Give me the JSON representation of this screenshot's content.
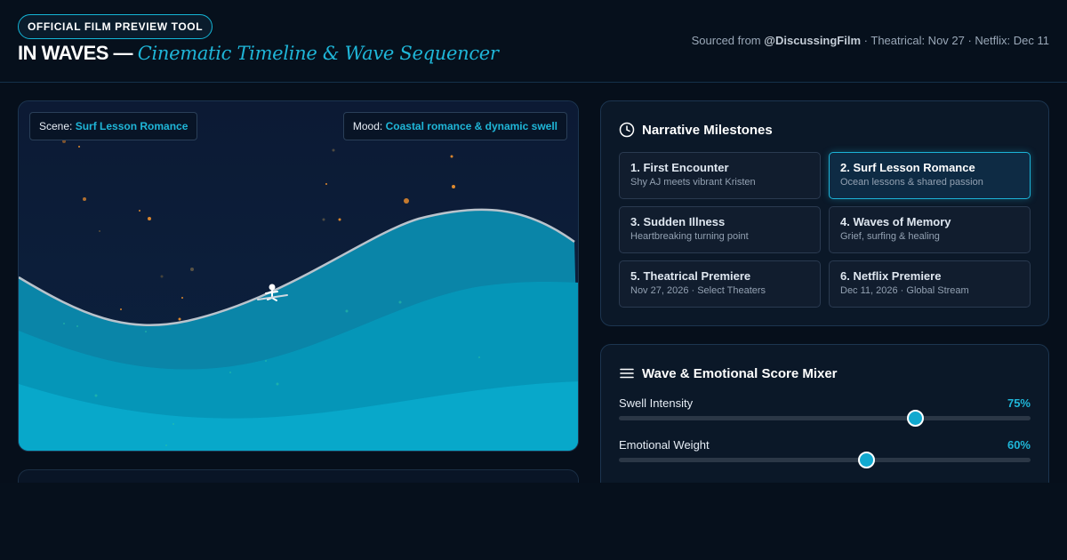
{
  "header": {
    "badge": "OFFICIAL FILM PREVIEW TOOL",
    "title_main": "IN WAVES —",
    "title_sub": "Cinematic Timeline & Wave Sequencer",
    "source_prefix": "Sourced from",
    "source_handle": "@DiscussingFilm",
    "source_rest": "· Theatrical: Nov 27 · Netflix: Dec 11"
  },
  "scene": {
    "scene_label": "Scene:",
    "scene_value": "Surf Lesson Romance",
    "mood_label": "Mood:",
    "mood_value": "Coastal romance & dynamic swell",
    "colors": {
      "sky": "#0b1a33",
      "wave_front": "#08a8ca",
      "wave_mid": "#0596b8",
      "wave_back": "#0a85a8",
      "crest": "#b9c3cc"
    }
  },
  "milestones": {
    "heading": "Narrative Milestones",
    "icon": "clock-icon",
    "items": [
      {
        "title": "1. First Encounter",
        "subtitle": "Shy AJ meets vibrant Kristen",
        "active": false
      },
      {
        "title": "2. Surf Lesson Romance",
        "subtitle": "Ocean lessons & shared passion",
        "active": true
      },
      {
        "title": "3. Sudden Illness",
        "subtitle": "Heartbreaking turning point",
        "active": false
      },
      {
        "title": "4. Waves of Memory",
        "subtitle": "Grief, surfing & healing",
        "active": false
      },
      {
        "title": "5. Theatrical Premiere",
        "subtitle": "Nov 27, 2026 · Select Theaters",
        "active": false
      },
      {
        "title": "6. Netflix Premiere",
        "subtitle": "Dec 11, 2026 · Global Stream",
        "active": false
      }
    ]
  },
  "mixer": {
    "heading": "Wave & Emotional Score Mixer",
    "icon": "menu-icon",
    "sliders": [
      {
        "label": "Swell Intensity",
        "value_text": "75%",
        "value": 0.72
      },
      {
        "label": "Emotional Weight",
        "value_text": "60%",
        "value": 0.6
      }
    ]
  },
  "accent_color": "#1fb6d8"
}
